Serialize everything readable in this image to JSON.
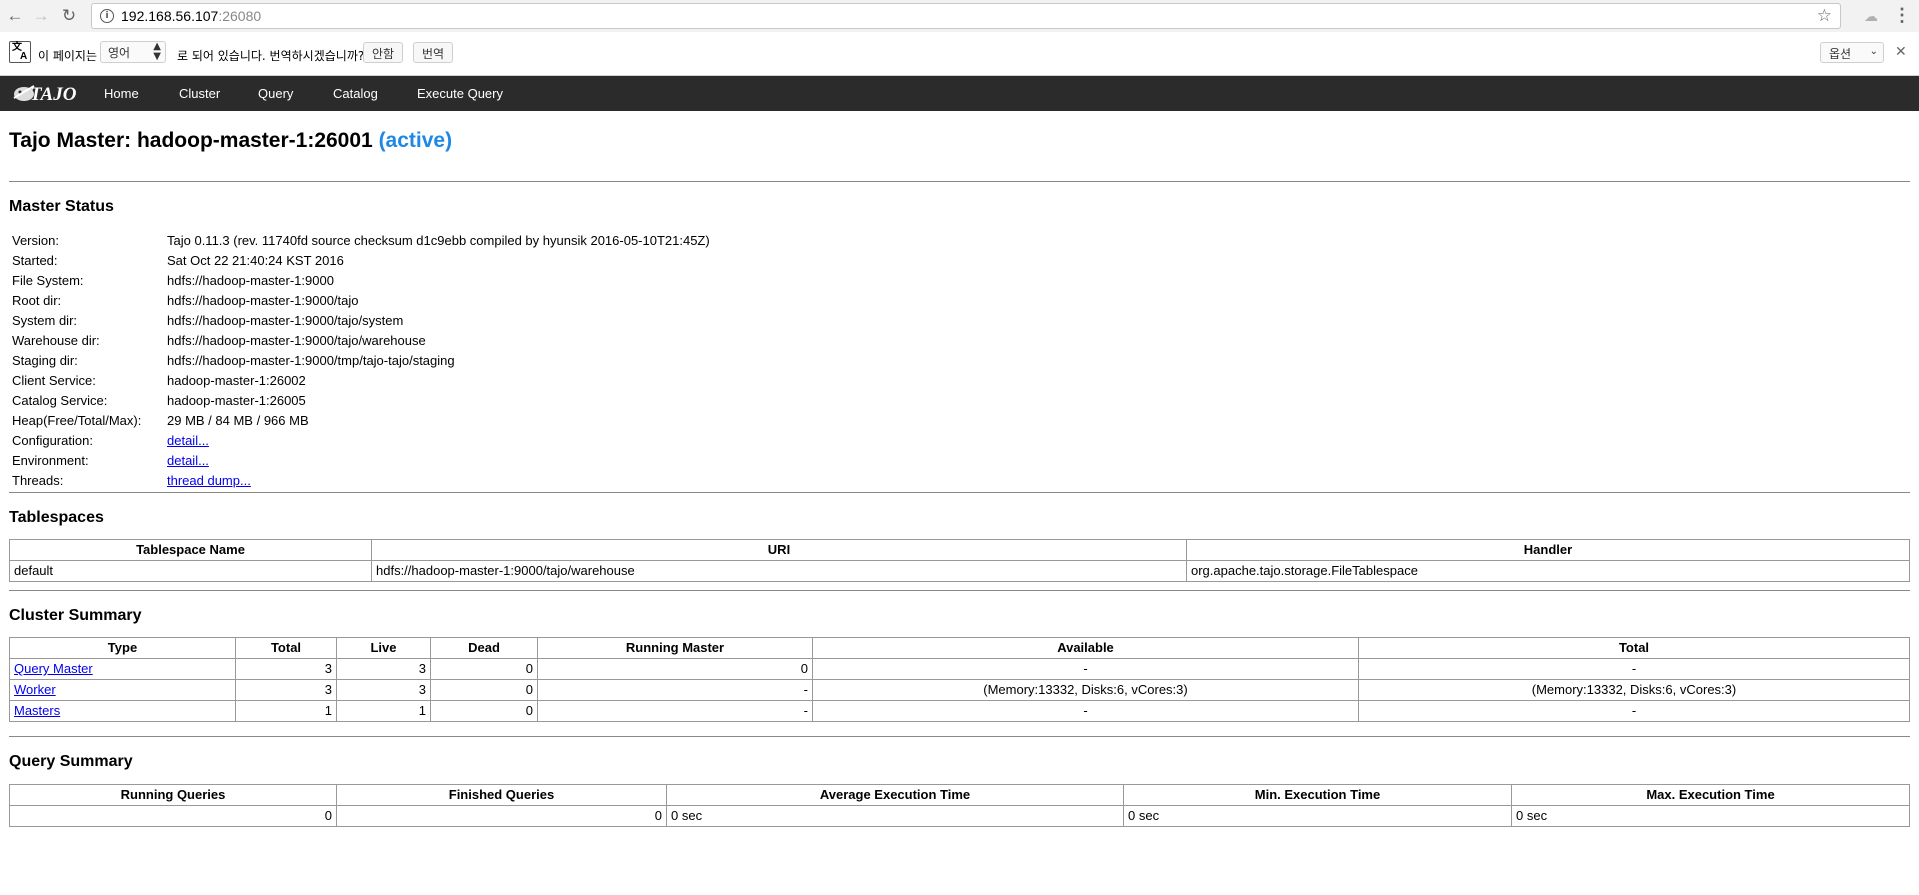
{
  "browser": {
    "url_host": "192.168.56.107",
    "url_port": ":26080"
  },
  "translate_bar": {
    "prefix": "이 페이지는",
    "language": "영어",
    "suffix": "로 되어 있습니다. 번역하시겠습니까?",
    "nope_button": "안함",
    "translate_button": "번역",
    "options": "옵션"
  },
  "menu": {
    "logo_text": "TAJO",
    "items": [
      "Home",
      "Cluster",
      "Query",
      "Catalog",
      "Execute Query"
    ]
  },
  "page": {
    "title": "Tajo Master: hadoop-master-1:26001",
    "status": "(active)"
  },
  "master_status": {
    "heading": "Master Status",
    "rows": [
      {
        "key": "Version:",
        "value": "Tajo 0.11.3 (rev. 11740fd source checksum d1c9ebb compiled by hyunsik 2016-05-10T21:45Z)"
      },
      {
        "key": "Started:",
        "value": "Sat Oct 22 21:40:24 KST 2016"
      },
      {
        "key": "File System:",
        "value": "hdfs://hadoop-master-1:9000"
      },
      {
        "key": "Root dir:",
        "value": "hdfs://hadoop-master-1:9000/tajo"
      },
      {
        "key": "System dir:",
        "value": "hdfs://hadoop-master-1:9000/tajo/system"
      },
      {
        "key": "Warehouse dir:",
        "value": "hdfs://hadoop-master-1:9000/tajo/warehouse"
      },
      {
        "key": "Staging dir:",
        "value": "hdfs://hadoop-master-1:9000/tmp/tajo-tajo/staging"
      },
      {
        "key": "Client Service:",
        "value": "hadoop-master-1:26002"
      },
      {
        "key": "Catalog Service:",
        "value": "hadoop-master-1:26005"
      },
      {
        "key": "Heap(Free/Total/Max):",
        "value": "29 MB / 84 MB / 966 MB"
      }
    ],
    "link_rows": [
      {
        "key": "Configuration:",
        "link": "detail..."
      },
      {
        "key": "Environment:",
        "link": "detail..."
      },
      {
        "key": "Threads:",
        "link": "thread dump..."
      }
    ]
  },
  "tablespaces": {
    "heading": "Tablespaces",
    "columns": [
      "Tablespace Name",
      "URI",
      "Handler"
    ],
    "rows": [
      [
        "default",
        "hdfs://hadoop-master-1:9000/tajo/warehouse",
        "org.apache.tajo.storage.FileTablespace"
      ]
    ]
  },
  "cluster_summary": {
    "heading": "Cluster Summary",
    "columns": [
      "Type",
      "Total",
      "Live",
      "Dead",
      "Running Master",
      "Available",
      "Total"
    ],
    "rows": [
      {
        "type": "Query Master",
        "total": "3",
        "live": "3",
        "dead": "0",
        "running_master": "0",
        "available": "-",
        "total_res": "-"
      },
      {
        "type": "Worker",
        "total": "3",
        "live": "3",
        "dead": "0",
        "running_master": "-",
        "available": "(Memory:13332, Disks:6, vCores:3)",
        "total_res": "(Memory:13332, Disks:6, vCores:3)"
      },
      {
        "type": "Masters",
        "total": "1",
        "live": "1",
        "dead": "0",
        "running_master": "-",
        "available": "-",
        "total_res": "-"
      }
    ]
  },
  "query_summary": {
    "heading": "Query Summary",
    "columns": [
      "Running Queries",
      "Finished Queries",
      "Average Execution Time",
      "Min. Execution Time",
      "Max. Execution Time"
    ],
    "row": [
      "0",
      "0",
      "0 sec",
      "0 sec",
      "0 sec"
    ]
  },
  "icons": [
    "back-arrow-icon",
    "forward-arrow-icon",
    "reload-icon",
    "info-icon",
    "bookmark-star-icon",
    "cloud-extension-icon",
    "menu-dots-icon",
    "translate-icon",
    "close-icon"
  ]
}
